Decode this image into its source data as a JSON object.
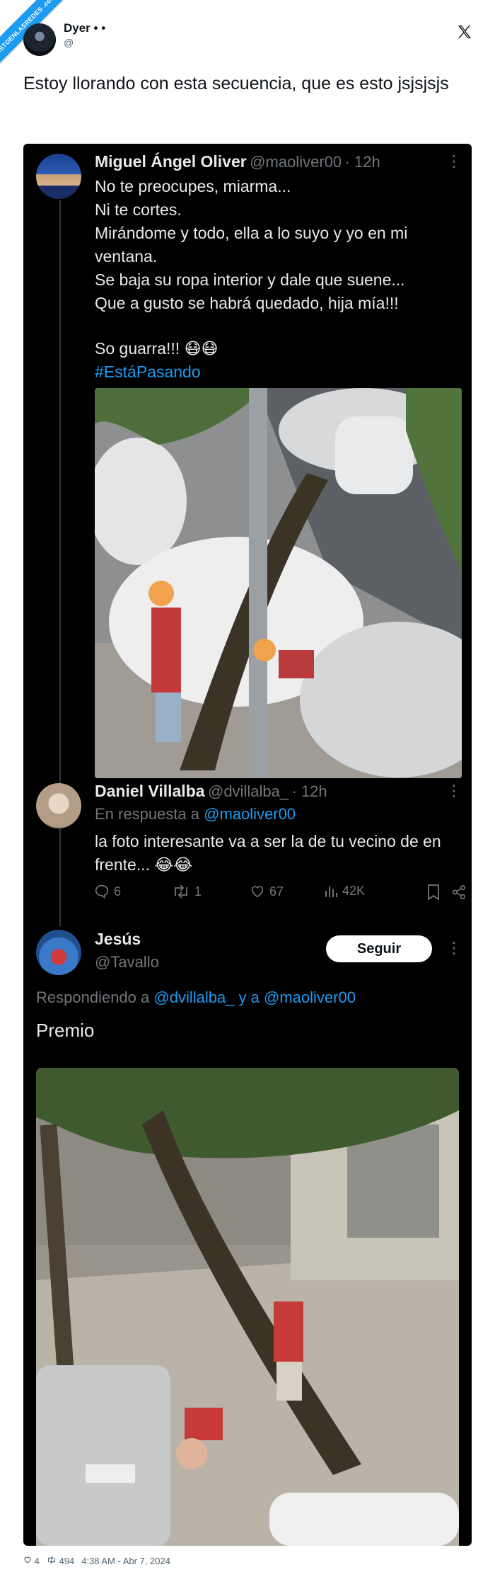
{
  "watermark": "VISTOENLASREDES .com",
  "author": {
    "name": "Dyer • •",
    "handle": "@"
  },
  "outer_tweet": {
    "text": "Estoy llorando con esta secuencia, que es esto jsjsjsjs"
  },
  "embedded": {
    "tweet1": {
      "name": "Miguel Ángel Oliver",
      "handle": "@maoliver00",
      "time": "· 12h",
      "text": "No te preocupes, miarma...\nNi te cortes.\nMirándome y todo, ella a lo suyo y yo en mi ventana.\nSe baja su ropa interior y dale que suene...\nQue a gusto se habrá quedado, hija mía!!!",
      "text2": "So guarra!!! 😷😷",
      "hashtag": "#EstáPasando"
    },
    "tweet2": {
      "name": "Daniel Villalba",
      "handle": "@dvillalba_",
      "time": "· 12h",
      "reply_prefix": "En respuesta a",
      "reply_to": "@maoliver00",
      "text": "la foto interesante va a ser la de tu vecino de en frente... 😂😂",
      "stats": {
        "replies": "6",
        "retweets": "1",
        "likes": "67",
        "views": "42K"
      }
    },
    "tweet3": {
      "name": "Jesús",
      "handle": "@Tavallo",
      "follow_label": "Seguir",
      "replying_prefix": "Respondiendo a",
      "replying_to": "@dvillalba_ y a @maoliver00",
      "text": "Premio"
    }
  },
  "footer": {
    "likes": "4",
    "retweets": "494",
    "timestamp": "4:38 AM - Abr 7, 2024"
  },
  "colors": {
    "accent": "#1d9bf0",
    "card_bg": "#000000",
    "muted": "#71767b"
  }
}
